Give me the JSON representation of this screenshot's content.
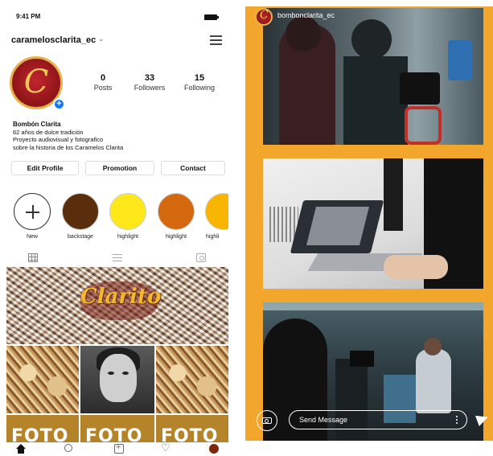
{
  "status_bar": {
    "time": "9:41 PM"
  },
  "profile": {
    "username": "caramelosclarita_ec",
    "avatar_letter": "C",
    "stats": [
      {
        "value": "0",
        "label": "Posts"
      },
      {
        "value": "33",
        "label": "Followers"
      },
      {
        "value": "15",
        "label": "Following"
      }
    ],
    "bio": {
      "name": "Bombón Clarita",
      "lines": [
        "62 años de dulce tradición",
        "Proyecto  audiovisual y fotografico",
        "sobre la historia de los Caramelos Clarita"
      ]
    },
    "buttons": [
      "Edit Profile",
      "Promotion",
      "Contact"
    ]
  },
  "highlights": [
    {
      "label": "New",
      "color": "#ffffff"
    },
    {
      "label": "backstage",
      "color": "#5a2e0c"
    },
    {
      "label": "highlight",
      "color": "#ffe81a"
    },
    {
      "label": "highlight",
      "color": "#d4680f"
    },
    {
      "label": "highli",
      "color": "#f7b500"
    }
  ],
  "posts": {
    "banner_text": "Clarito",
    "tile_text": [
      "FOTO",
      "FOTO",
      "FOTO"
    ]
  },
  "story": {
    "username": "bombonclarita_ec",
    "message_placeholder": "Send Message",
    "background": "#f2a72c"
  }
}
